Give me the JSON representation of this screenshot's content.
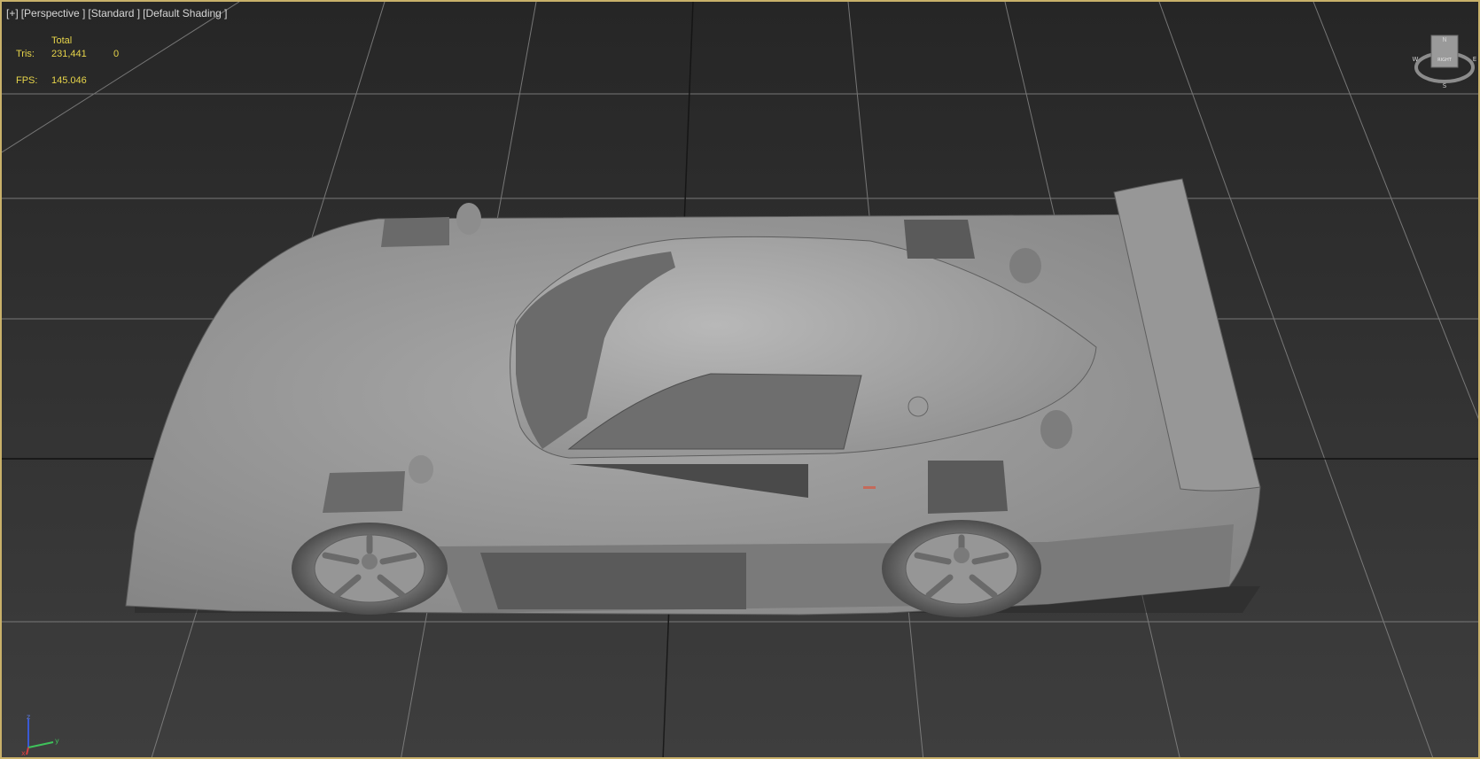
{
  "viewport": {
    "labels": [
      "[+]",
      "[Perspective ]",
      "[Standard ]",
      "[Default Shading ]"
    ],
    "stats": {
      "total_header": "Total",
      "tris_label": "Tris:",
      "tris_total": "231,441",
      "tris_selected": "0",
      "fps_label": "FPS:",
      "fps_value": "145.046"
    }
  },
  "viewcube": {
    "face_label": "RIGHT",
    "compass": [
      "W",
      "N",
      "S",
      "E"
    ]
  },
  "axis": {
    "z": "z",
    "y": "y",
    "x": "x"
  },
  "colors": {
    "frame_border": "#c9b16a",
    "stats_text": "#e6d44a",
    "label_text": "#d6d6d6",
    "grid_line": "#8a8a8a",
    "axis_z": "#3a5ad6",
    "axis_y": "#3fc25b",
    "axis_x": "#d64040"
  }
}
